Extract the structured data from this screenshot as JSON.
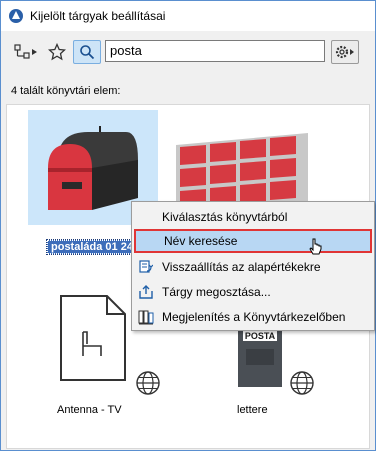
{
  "window": {
    "title": "Kijelölt tárgyak beállításai"
  },
  "toolbar": {
    "search_value": "posta",
    "icons": [
      "tree-view-icon",
      "star-icon",
      "search-icon",
      "gear-icon"
    ]
  },
  "results": {
    "count_label": "4 talált könyvtári elem:",
    "items": [
      {
        "label": "postaláda 01 24",
        "selected": true
      },
      {
        "label": "Antenna - TV",
        "selected": false
      },
      {
        "label": "lettere",
        "selected": false
      }
    ]
  },
  "context_menu": {
    "items": [
      {
        "label": "Kiválasztás könyvtárból",
        "icon": "none"
      },
      {
        "label": "Név keresése",
        "icon": "search-name-icon",
        "highlighted": true
      },
      {
        "label": "Visszaállítás az alapértékekre",
        "icon": "reset-icon"
      },
      {
        "label": "Tárgy megosztása...",
        "icon": "share-icon"
      },
      {
        "label": "Megjelenítés a Könyvtárkezelőben",
        "icon": "library-manager-icon"
      }
    ]
  },
  "colors": {
    "selection": "#3d6dba",
    "highlight": "#b8d7f3",
    "highlight_border": "#e03535",
    "mailbox_red": "#d93640"
  }
}
